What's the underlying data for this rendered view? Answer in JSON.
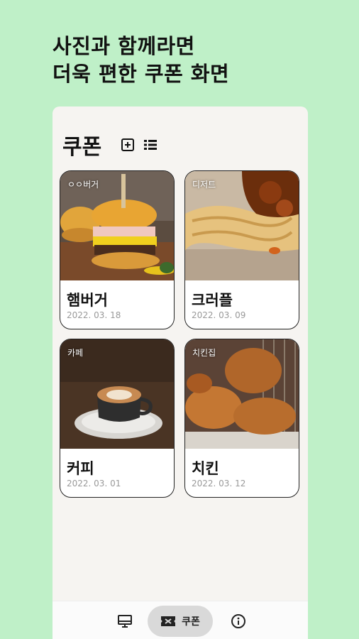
{
  "promo": {
    "line1": "사진과 함께라면",
    "line2": "더욱 편한 쿠폰 화면"
  },
  "header": {
    "title": "쿠폰",
    "add_icon": "add-box-icon",
    "list_icon": "list-view-icon"
  },
  "coupons": [
    {
      "category": "ㅇㅇ버거",
      "name": "햄버거",
      "date": "2022. 03. 18"
    },
    {
      "category": "디저트",
      "name": "크러플",
      "date": "2022. 03. 09"
    },
    {
      "category": "카페",
      "name": "커피",
      "date": "2022. 03. 01"
    },
    {
      "category": "치킨집",
      "name": "치킨",
      "date": "2022. 03. 12"
    }
  ],
  "bottom_nav": {
    "items": [
      {
        "icon": "display-icon",
        "label": ""
      },
      {
        "icon": "coupon-icon",
        "label": "쿠폰",
        "active": true
      },
      {
        "icon": "info-icon",
        "label": ""
      }
    ]
  },
  "colors": {
    "background": "#bff0c8",
    "panel": "#f6f4f1",
    "nav_active": "#d9d9d9"
  }
}
